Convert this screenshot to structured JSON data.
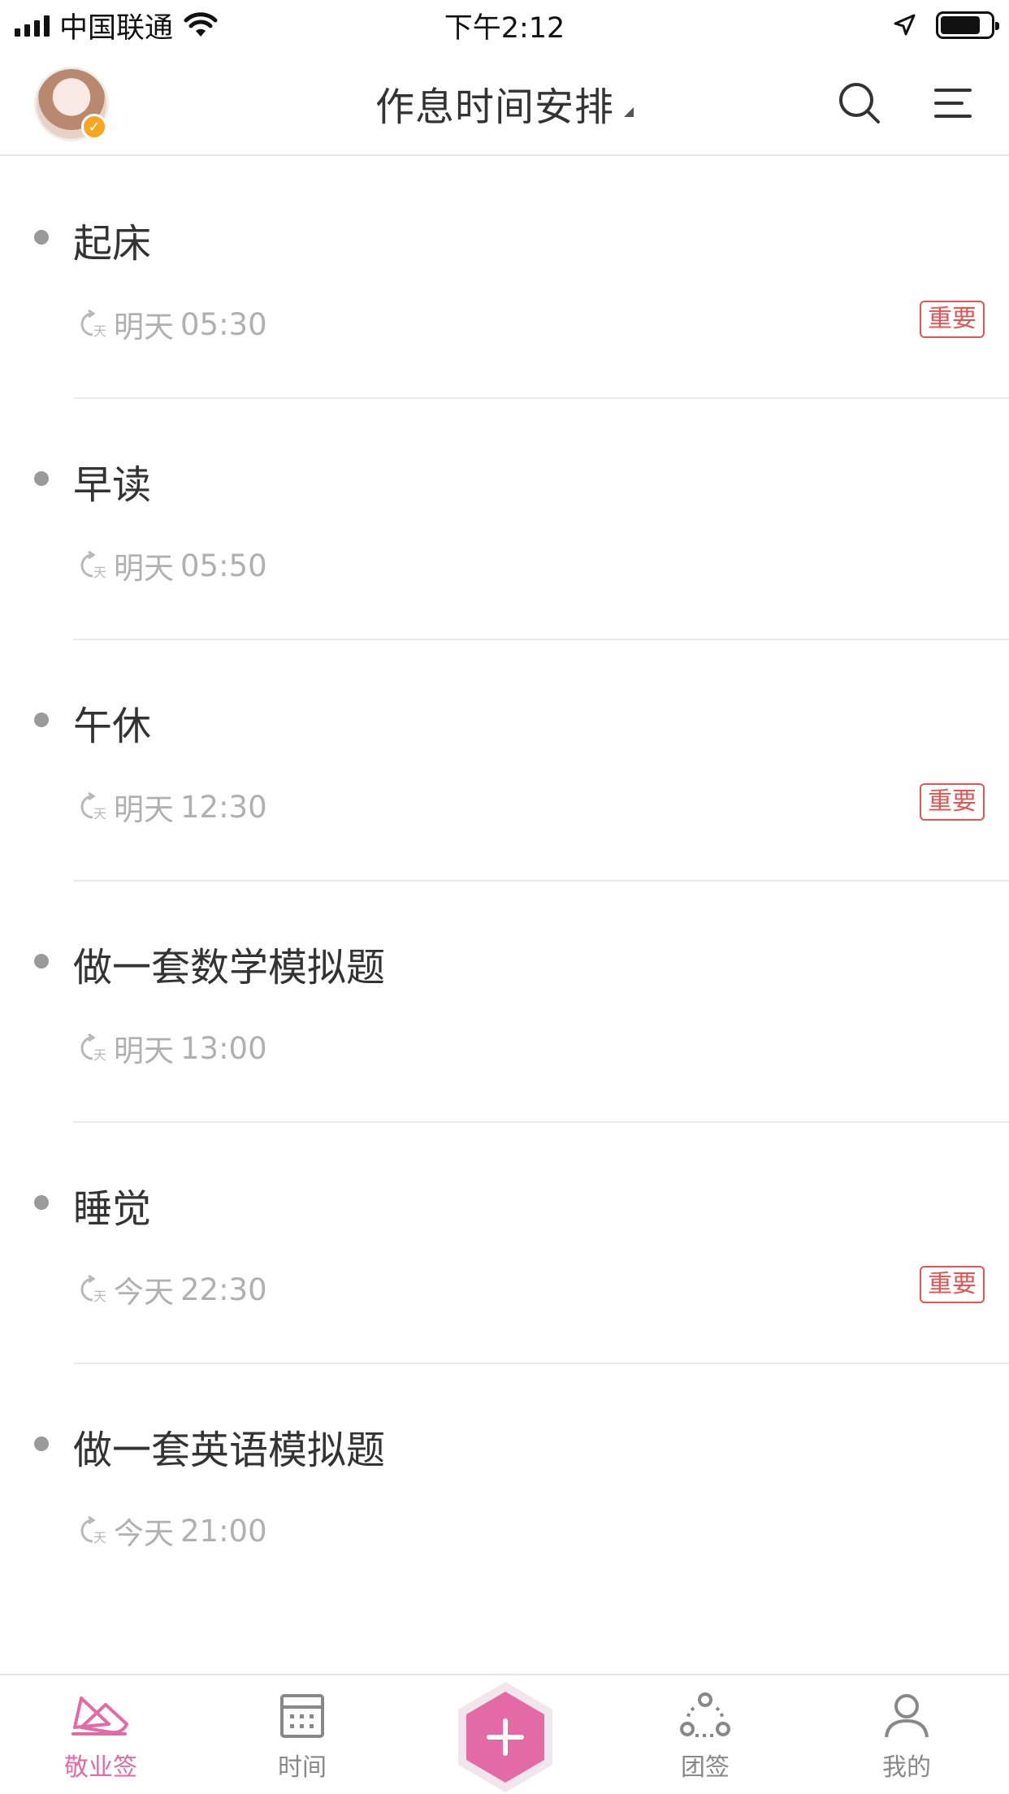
{
  "status_bar": {
    "carrier": "中国联通",
    "time": "下午2:12"
  },
  "header": {
    "title": "作息时间安排"
  },
  "items": [
    {
      "title": "起床",
      "day": "明天",
      "time": "05:30",
      "tag": "重要"
    },
    {
      "title": "早读",
      "day": "明天",
      "time": "05:50",
      "tag": ""
    },
    {
      "title": "午休",
      "day": "明天",
      "time": "12:30",
      "tag": "重要"
    },
    {
      "title": "做一套数学模拟题",
      "day": "明天",
      "time": "13:00",
      "tag": ""
    },
    {
      "title": "睡觉",
      "day": "今天",
      "time": "22:30",
      "tag": "重要"
    },
    {
      "title": "做一套英语模拟题",
      "day": "今天",
      "time": "21:00",
      "tag": ""
    }
  ],
  "tabbar": {
    "tabs": [
      {
        "label": "敬业签",
        "icon": "notes-icon",
        "active": true
      },
      {
        "label": "时间",
        "icon": "calendar-icon",
        "active": false
      },
      {
        "label": "团签",
        "icon": "team-icon",
        "active": false
      },
      {
        "label": "我的",
        "icon": "user-icon",
        "active": false
      }
    ],
    "add_icon": "plus-icon"
  },
  "colors": {
    "accent": "#e46aa5",
    "tag": "#e25555",
    "muted": "#b0b0b0"
  }
}
